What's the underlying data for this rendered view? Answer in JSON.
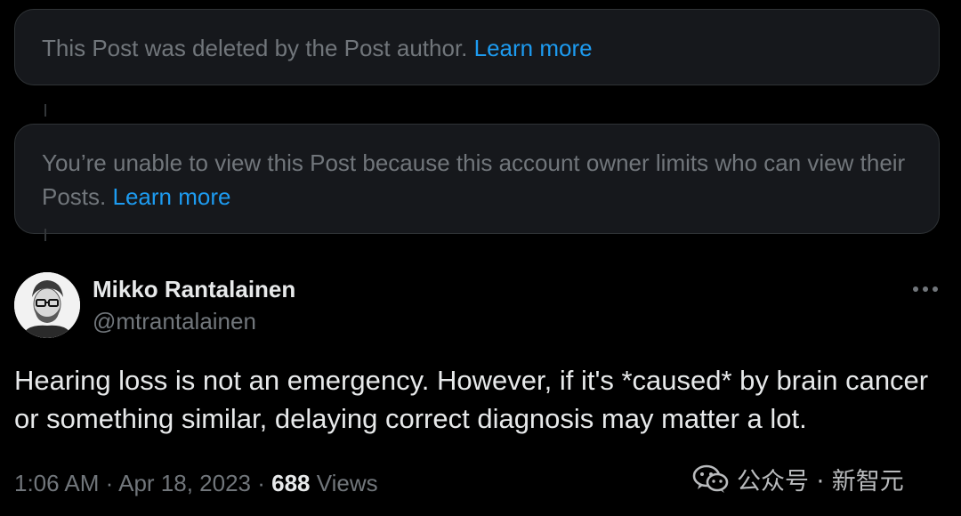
{
  "notices": [
    {
      "text": "This Post was deleted by the Post author.",
      "link": "Learn more"
    },
    {
      "text": "You’re unable to view this Post because this account owner limits who can view their Posts.",
      "link": "Learn more"
    }
  ],
  "post": {
    "author_name": "Mikko Rantalainen",
    "author_handle": "@mtrantalainen",
    "text": "Hearing loss is not an emergency. However, if it's *caused* by brain cancer or something similar, delaying correct diagnosis may matter a lot.",
    "time": "1:06 AM",
    "separator": "·",
    "date": "Apr 18, 2023",
    "views_count": "688",
    "views_label": "Views",
    "more_icon": "more-horizontal-icon",
    "avatar_icon": "user-avatar"
  },
  "watermark": {
    "text": "公众号 · 新智元",
    "icon": "wechat-icon"
  },
  "colors": {
    "background": "#000000",
    "card": "#16181c",
    "border": "#2f3336",
    "secondary_text": "#71767b",
    "primary_text": "#e7e9ea",
    "link": "#1d9bf0"
  }
}
